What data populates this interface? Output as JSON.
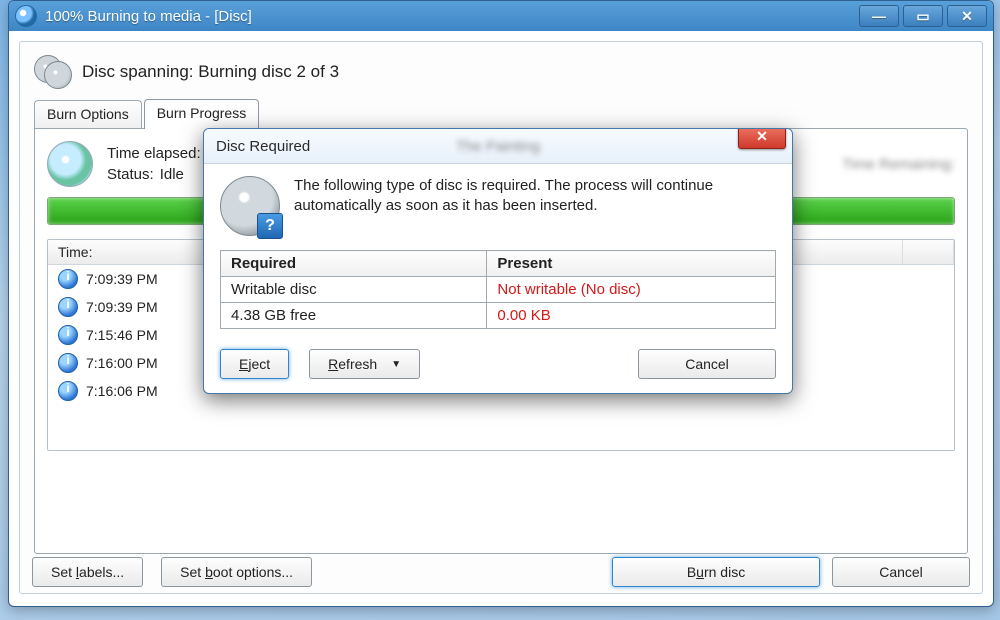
{
  "window": {
    "title": "100% Burning to media - [Disc]"
  },
  "header": {
    "spanning_text": "Disc spanning: Burning disc 2 of 3"
  },
  "tabs": {
    "options_label": "Burn Options",
    "progress_label": "Burn Progress",
    "active": "progress"
  },
  "progress": {
    "time_elapsed_label": "Time elapsed:",
    "status_label": "Status:",
    "status_value": "Idle",
    "time_remaining_label": "Time Remaining:",
    "percent": 100
  },
  "log": {
    "time_header": "Time:",
    "rows": [
      {
        "time": "7:09:39 PM"
      },
      {
        "time": "7:09:39 PM"
      },
      {
        "time": "7:15:46 PM"
      },
      {
        "time": "7:16:00 PM"
      },
      {
        "time": "7:16:06 PM"
      }
    ]
  },
  "bottom": {
    "set_labels": "Set labels...",
    "set_boot": "Set boot options...",
    "burn": "Burn disc",
    "cancel": "Cancel",
    "accel_labels": "l",
    "accel_boot": "b",
    "accel_burn": "u"
  },
  "modal": {
    "title": "Disc Required",
    "message": "The following type of disc is required. The process will continue automatically as soon as it has been inserted.",
    "table": {
      "required_header": "Required",
      "present_header": "Present",
      "rows": [
        {
          "required": "Writable disc",
          "present": "Not writable (No disc)",
          "error": true
        },
        {
          "required": "4.38 GB free",
          "present": "0.00 KB",
          "error": true
        }
      ]
    },
    "buttons": {
      "eject": "Eject",
      "refresh": "Refresh",
      "cancel": "Cancel",
      "accel_eject": "E",
      "accel_refresh": "R"
    }
  }
}
